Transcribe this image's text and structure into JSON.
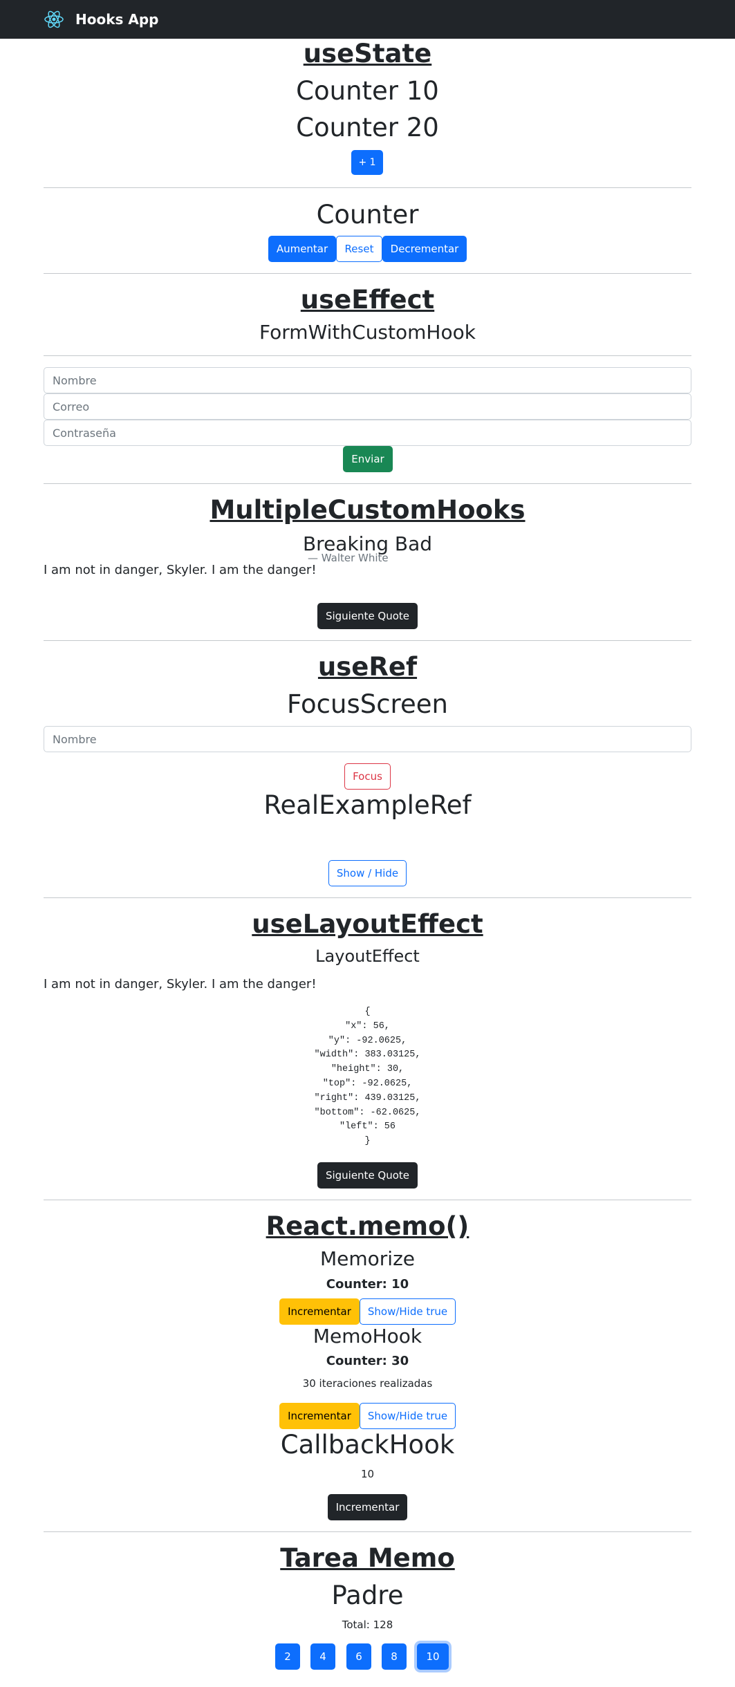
{
  "navbar": {
    "brand": "Hooks App",
    "logo_icon": "react-atom-icon"
  },
  "use_state": {
    "title": "useState",
    "counter1": "Counter 10",
    "counter2": "Counter 20",
    "plus_button": "+ 1"
  },
  "counter": {
    "title": "Counter",
    "increase": "Aumentar",
    "reset": "Reset",
    "decrease": "Decrementar"
  },
  "use_effect": {
    "title": "useEffect",
    "subtitle": "FormWithCustomHook",
    "name_placeholder": "Nombre",
    "email_placeholder": "Correo",
    "password_placeholder": "Contraseña",
    "submit": "Enviar"
  },
  "multiple_custom_hooks": {
    "title": "MultipleCustomHooks",
    "subtitle": "Breaking Bad",
    "author": "— Walter White",
    "quote": "I am not in danger, Skyler. I am the danger!",
    "next_button": "Siguiente Quote"
  },
  "use_ref": {
    "title": "useRef",
    "subtitle": "FocusScreen",
    "name_placeholder": "Nombre",
    "focus_button": "Focus",
    "real_example_title": "RealExampleRef",
    "show_hide_button": "Show / Hide"
  },
  "use_layout_effect": {
    "title": "useLayoutEffect",
    "subtitle": "LayoutEffect",
    "quote": "I am not in danger, Skyler. I am the danger!",
    "rect_lines": [
      "{",
      "\"x\": 56,",
      "\"y\": -92.0625,",
      "\"width\": 383.03125,",
      "\"height\": 30,",
      "\"top\": -92.0625,",
      "\"right\": 439.03125,",
      "\"bottom\": -62.0625,",
      "\"left\": 56",
      "}"
    ],
    "next_button": "Siguiente Quote"
  },
  "react_memo": {
    "title": "React.memo()",
    "memorize_title": "Memorize",
    "memorize_counter": "Counter: 10",
    "memorize_increment": "Incrementar",
    "memorize_toggle": "Show/Hide true",
    "memohook_title": "MemoHook",
    "memohook_counter": "Counter: 30",
    "memohook_iterations": "30 iteraciones realizadas",
    "memohook_increment": "Incrementar",
    "memohook_toggle": "Show/Hide true",
    "callback_title": "CallbackHook",
    "callback_value": "10",
    "callback_increment": "Incrementar"
  },
  "tarea_memo": {
    "title": "Tarea Memo",
    "subtitle": "Padre",
    "total": "Total: 128",
    "numbers": [
      "2",
      "4",
      "6",
      "8",
      "10"
    ]
  },
  "colors": {
    "navbar": "#212529",
    "primary": "#0d6efd",
    "success": "#198754",
    "dark": "#212529",
    "danger": "#dc3545",
    "warning": "#ffc107"
  }
}
